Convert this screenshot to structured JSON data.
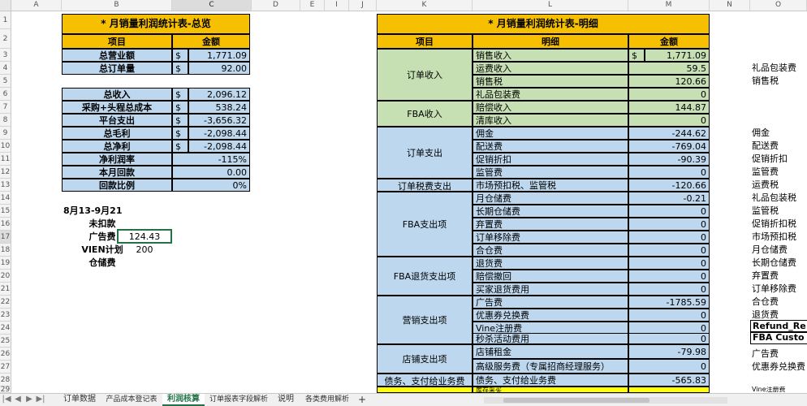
{
  "columns": [
    "A",
    "B",
    "C",
    "D",
    "E",
    "I",
    "J",
    "K",
    "L",
    "M",
    "N",
    "O"
  ],
  "rows": [
    "1",
    "2",
    "3",
    "4",
    "5",
    "6",
    "7",
    "8",
    "9",
    "10",
    "11",
    "12",
    "13",
    "14",
    "15",
    "16",
    "17",
    "18",
    "19",
    "20",
    "21",
    "22",
    "23",
    "24",
    "25",
    "26",
    "27",
    "28",
    "29"
  ],
  "summary": {
    "title": "* 月销量利润统计表-总览",
    "h_item": "项目",
    "h_amount": "金额",
    "r3": {
      "label": "总营业额",
      "cur": "$",
      "val": "1,771.09"
    },
    "r4": {
      "label": "总订单量",
      "cur": "$",
      "val": "92.00"
    },
    "r6": {
      "label": "总收入",
      "cur": "$",
      "val": "2,096.12"
    },
    "r7": {
      "label": "采购+头程总成本",
      "cur": "$",
      "val": "538.24"
    },
    "r8": {
      "label": "平台支出",
      "cur": "$",
      "val": "-3,656.32"
    },
    "r9": {
      "label": "总毛利",
      "cur": "$",
      "val": "-2,098.44"
    },
    "r10": {
      "label": "总净利",
      "cur": "$",
      "val": "-2,098.44"
    },
    "r11": {
      "label": "净利润率",
      "val": "-115%"
    },
    "r12": {
      "label": "本月回款",
      "val": "0.00"
    },
    "r13": {
      "label": "回款比例",
      "val": "0%"
    }
  },
  "notes": {
    "date_range": "8月13-9月21",
    "unpaid": "未扣款",
    "ad_label": "广告费",
    "ad_value": "124.43",
    "vien_label": "VIEN计划",
    "vien_value": "200",
    "storage_label": "仓储费"
  },
  "detail": {
    "title": "* 月销量利润统计表-明细",
    "h_item": "项目",
    "h_detail": "明细",
    "h_amount": "金额",
    "g_order_income": "订单收入",
    "g_fba_income": "FBA收入",
    "g_order_exp": "订单支出",
    "g_order_tax": "订单税费支出",
    "g_fba_exp": "FBA支出项",
    "g_fba_return": "FBA退货支出项",
    "g_marketing": "营销支出项",
    "g_store": "店铺支出项",
    "g_tax_pay": "债务、支付给业务费",
    "items": [
      {
        "name": "销售收入",
        "cur": "$",
        "val": "1,771.09"
      },
      {
        "name": "运费收入",
        "cur": "",
        "val": "59.5"
      },
      {
        "name": "销售税",
        "cur": "",
        "val": "120.66"
      },
      {
        "name": "礼品包装费",
        "cur": "",
        "val": "0"
      },
      {
        "name": "赔偿收入",
        "cur": "",
        "val": "144.87"
      },
      {
        "name": "清库收入",
        "cur": "",
        "val": "0"
      },
      {
        "name": "佣金",
        "cur": "",
        "val": "-244.62"
      },
      {
        "name": "配送费",
        "cur": "",
        "val": "-769.04"
      },
      {
        "name": "促销折扣",
        "cur": "",
        "val": "-90.39"
      },
      {
        "name": "监管费",
        "cur": "",
        "val": "0"
      },
      {
        "name": "市场预扣税、监管税",
        "cur": "",
        "val": "-120.66"
      },
      {
        "name": "月仓储费",
        "cur": "",
        "val": "-0.21"
      },
      {
        "name": "长期仓储费",
        "cur": "",
        "val": "0"
      },
      {
        "name": "弃置费",
        "cur": "",
        "val": "0"
      },
      {
        "name": "订单移除费",
        "cur": "",
        "val": "0"
      },
      {
        "name": "合仓费",
        "cur": "",
        "val": "0"
      },
      {
        "name": "退货费",
        "cur": "",
        "val": "0"
      },
      {
        "name": "赔偿撤回",
        "cur": "",
        "val": "0"
      },
      {
        "name": "买家退货费用",
        "cur": "",
        "val": "0"
      },
      {
        "name": "广告费",
        "cur": "",
        "val": "-1785.59"
      },
      {
        "name": "优惠券兑换费",
        "cur": "",
        "val": "0"
      },
      {
        "name": "Vine注册费",
        "cur": "",
        "val": "0"
      },
      {
        "name": "秒杀活动费用",
        "cur": "",
        "val": "0"
      },
      {
        "name": "店铺租金",
        "cur": "",
        "val": "-79.98"
      },
      {
        "name": "高级服务费（专属招商经理服务）",
        "cur": "",
        "val": "0"
      },
      {
        "name": "债务、支付给业务费",
        "cur": "",
        "val": "-565.83"
      },
      {
        "name": "库存采买",
        "cur": "",
        "val": ""
      }
    ]
  },
  "right_list": [
    "礼品包装费",
    "销售税",
    "佣金",
    "配送费",
    "促销折扣",
    "监管费",
    "运费税",
    "礼品包装税",
    "监管税",
    "促销折扣税",
    "市场预扣税",
    "月仓储费",
    "长期仓储费",
    "弃置费",
    "订单移除费",
    "合仓费",
    "退货费",
    "Refund_Re",
    "FBA Custo",
    "广告费",
    "优惠券兑换费",
    "Vine注册费"
  ],
  "tabs": [
    "订单数据",
    "产品成本登记表",
    "利润核算",
    "订单报表字段解析",
    "说明",
    "各类费用解析"
  ],
  "active_tab_index": 2,
  "add_sheet": "+"
}
